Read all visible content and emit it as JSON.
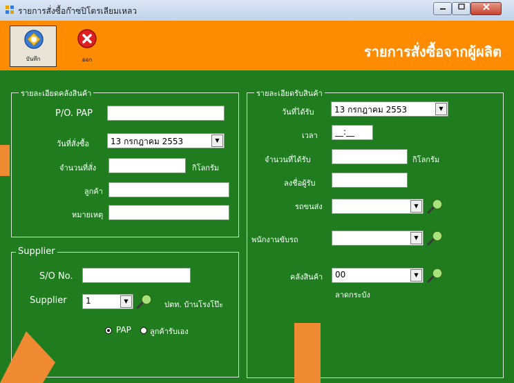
{
  "window": {
    "title": "รายการสั่งซื้อก๊าซปิโตรเลียมเหลว"
  },
  "toolbar": {
    "save_label": "บันทึก",
    "exit_label": "ออก"
  },
  "header": {
    "title": "รายการสั่งซื้อจากผู้ผลิต"
  },
  "stock_group": {
    "legend": "รายละเอียดคลังสินค้า",
    "po_label": "P/O. PAP",
    "po_value": "",
    "order_date_label": "วันที่สั่งซื้อ",
    "order_date": "13 กรกฎาคม  2553",
    "qty_label": "จำนวนที่สั่ง",
    "qty_value": "",
    "qty_unit": "กิโลกรัม",
    "customer_label": "ลูกค้า",
    "customer_value": "",
    "note_label": "หมายเหตุ",
    "note_value": ""
  },
  "supplier_group": {
    "legend": "Supplier",
    "so_label": "S/O No.",
    "so_value": "",
    "supplier_label": "Supplier",
    "supplier_value": "1",
    "supplier_name": "ปตท. บ้านโรงโป๊ะ",
    "radio_pap": "PAP",
    "radio_self": "ลูกค้ารับเอง",
    "selected": "PAP"
  },
  "receive_group": {
    "legend": "รายละเอียดรับสินค้า",
    "date_label": "วันที่ได้รับ",
    "date_value": "13 กรกฎาคม  2553",
    "time_label": "เวลา",
    "time_value": "__:__",
    "qty_label": "จำนวนที่ได้รับ",
    "qty_value": "",
    "qty_unit": "กิโลกรัม",
    "signer_label": "ลงชื่อผู้รับ",
    "signer_value": "",
    "truck_label": "รถขนส่ง",
    "truck_value": "",
    "driver_label": "พนักงานขับรถ",
    "driver_value": "",
    "warehouse_label": "คลังสินค้า",
    "warehouse_value": "00",
    "warehouse_name": "ลาดกระบัง"
  },
  "colors": {
    "background": "#1f7d1f",
    "toolbar": "#ff8c00",
    "accent": "#f08a32"
  }
}
